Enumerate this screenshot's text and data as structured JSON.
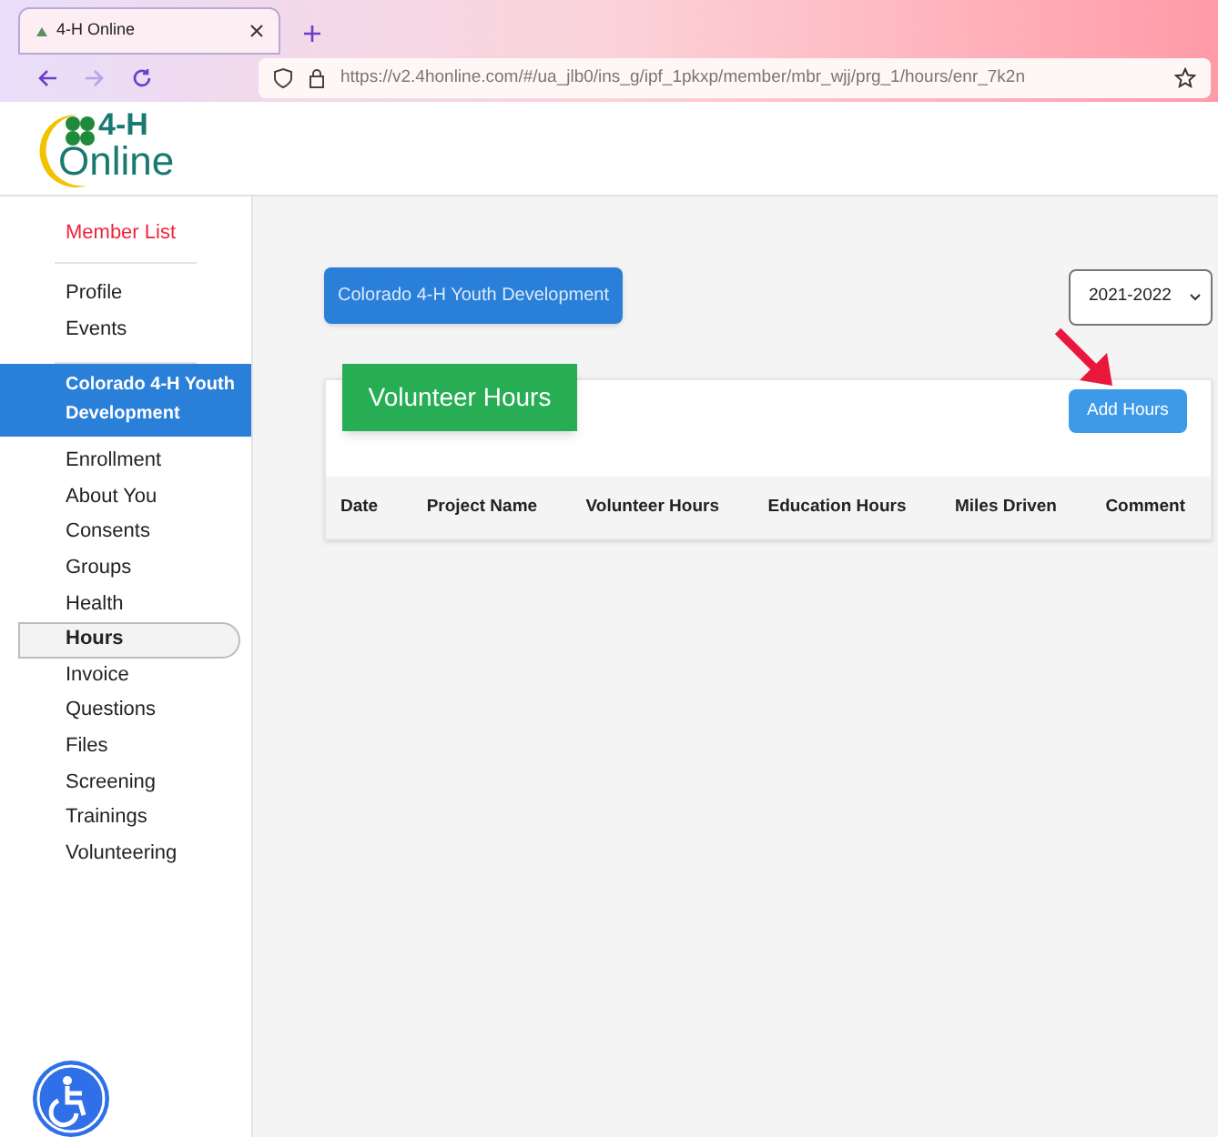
{
  "browser": {
    "tab": {
      "title": "4-H Online",
      "selected": true
    },
    "url_host": "https://v2.4honline.com",
    "url_path": "/#/ua_jlb0/ins_g/ipf_1pkxp/member/mbr_wjj/prg_1/hours/enr_7k2n"
  },
  "logo": {
    "line1": "4-H",
    "line2": "Online"
  },
  "sidebar": {
    "member_list": "Member List",
    "groups": [
      {
        "items": [
          {
            "label": "Profile",
            "selected": false
          },
          {
            "label": "Events",
            "selected": false
          }
        ]
      },
      {
        "header": {
          "label": "Colorado 4-H Youth Development",
          "selected": true
        },
        "items": [
          {
            "label": "Enrollment",
            "selected": false
          },
          {
            "label": "About You",
            "selected": false
          },
          {
            "label": "Consents",
            "selected": false
          },
          {
            "label": "Groups",
            "selected": false
          },
          {
            "label": "Health",
            "selected": false
          },
          {
            "label": "Hours",
            "selected": true
          },
          {
            "label": "Invoice",
            "selected": false
          },
          {
            "label": "Questions",
            "selected": false
          },
          {
            "label": "Files",
            "selected": false
          },
          {
            "label": "Screening",
            "selected": false
          },
          {
            "label": "Trainings",
            "selected": false
          },
          {
            "label": "Volunteering",
            "selected": false
          }
        ]
      }
    ]
  },
  "main": {
    "program_button": "Colorado 4-H Youth Development",
    "year_select": {
      "value": "2021-2022"
    },
    "card": {
      "title": "Volunteer Hours",
      "add_button": "Add Hours",
      "columns": [
        "Date",
        "Project Name",
        "Volunteer Hours",
        "Education Hours",
        "Miles Driven",
        "Comment"
      ]
    }
  }
}
